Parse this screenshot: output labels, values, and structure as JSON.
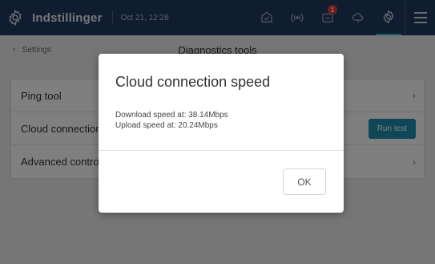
{
  "topbar": {
    "title": "Indstillinger",
    "datetime": "Oct 21, 12:28",
    "notification_count": "1",
    "icons": [
      "gear-icon",
      "shield-check-icon",
      "wireless-signal-icon",
      "inbox-icon",
      "cloud-icon",
      "settings-gear-icon",
      "hamburger-menu-icon"
    ],
    "accent_color": "#26b3c7",
    "bar_color": "#1e3a5f"
  },
  "subheader": {
    "back_label": "Settings",
    "page_title": "Diagnostics tools"
  },
  "tools": [
    {
      "label": "Ping tool"
    },
    {
      "label": "Cloud connection speed",
      "action": "Run test"
    },
    {
      "label": "Advanced controller diagnostics"
    }
  ],
  "dialog": {
    "title": "Cloud connection speed",
    "download": "Download speed at: 38.14Mbps",
    "upload": "Upload speed at: 20.24Mbps",
    "ok_label": "OK"
  }
}
